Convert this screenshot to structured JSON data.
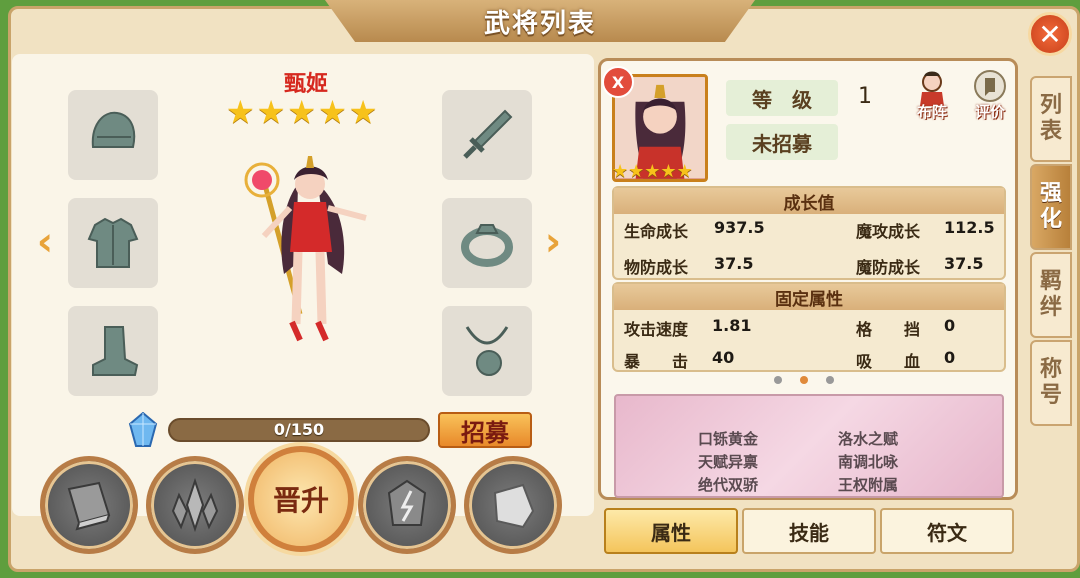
{
  "window": {
    "title": "武将列表",
    "close_label": "✕"
  },
  "hero": {
    "name": "甄姬",
    "stars": [
      "★",
      "★",
      "★",
      "★",
      "★"
    ],
    "nav_prev": "‹",
    "nav_next": "›"
  },
  "equipment": {
    "left": [
      "helmet-icon",
      "armor-icon",
      "boots-icon"
    ],
    "right": [
      "sword-icon",
      "ring-icon",
      "necklace-icon"
    ]
  },
  "shards": {
    "progress_text": "0/150",
    "current": 0,
    "max": 150,
    "recruit_label": "招募"
  },
  "actions": {
    "promote_label": "晋升"
  },
  "info": {
    "level_label": "等　级",
    "level_value": "1",
    "status": "未招募",
    "badge": "X",
    "formation_label": "布阵",
    "review_label": "评价",
    "portrait_stars": [
      "★",
      "★",
      "★",
      "★",
      "★"
    ]
  },
  "growth": {
    "title": "成长值",
    "stats": [
      {
        "label": "生命成长",
        "value": "937.5"
      },
      {
        "label": "魔攻成长",
        "value": "112.5"
      },
      {
        "label": "物防成长",
        "value": "37.5"
      },
      {
        "label": "魔防成长",
        "value": "37.5"
      }
    ]
  },
  "fixed": {
    "title": "固定属性",
    "stats": [
      {
        "label": "攻击速度",
        "value": "1.81"
      },
      {
        "label": "格　　挡",
        "value": "0"
      },
      {
        "label": "暴　　击",
        "value": "40"
      },
      {
        "label": "吸　　血",
        "value": "0"
      }
    ]
  },
  "talents": [
    "口铄黄金",
    "洛水之赋",
    "天赋异禀",
    "南调北咏",
    "绝代双骄",
    "王权附属"
  ],
  "bottom_tabs": [
    "属性",
    "技能",
    "符文"
  ],
  "side_tabs": [
    "列表",
    "强化",
    "羁绊",
    "称号"
  ]
}
